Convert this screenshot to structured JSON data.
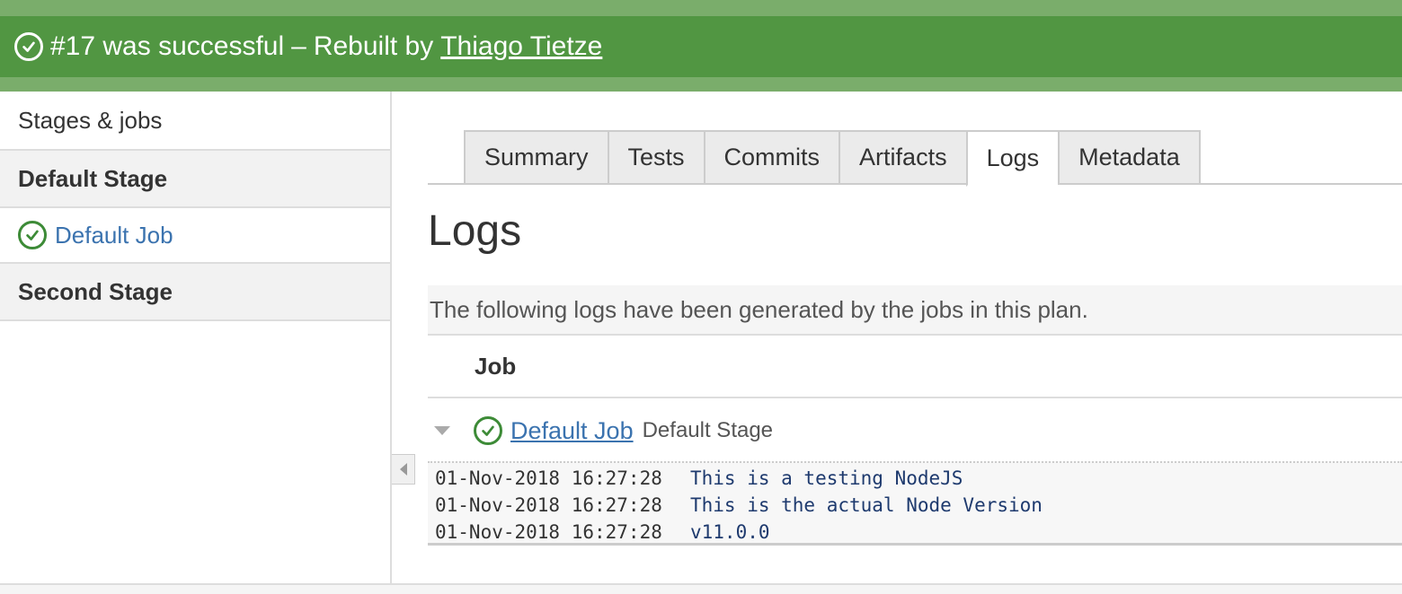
{
  "banner": {
    "status_text": "#17 was successful",
    "separator": "–",
    "rebuilt_text": "Rebuilt by",
    "user_link": "Thiago Tietze",
    "color": "#519642"
  },
  "sidebar": {
    "header": "Stages & jobs",
    "stages": [
      {
        "name": "Default Stage",
        "jobs": [
          "Default Job"
        ]
      },
      {
        "name": "Second Stage",
        "jobs": []
      }
    ]
  },
  "tabs": [
    "Summary",
    "Tests",
    "Commits",
    "Artifacts",
    "Logs",
    "Metadata"
  ],
  "active_tab": "Logs",
  "page": {
    "title": "Logs",
    "description": "The following logs have been generated by the jobs in this plan."
  },
  "table": {
    "column_header": "Job",
    "job": {
      "name": "Default Job",
      "stage": "Default Stage"
    },
    "logs": [
      {
        "time": "01-Nov-2018 16:27:28",
        "message": "This is a testing NodeJS"
      },
      {
        "time": "01-Nov-2018 16:27:28",
        "message": "This is the actual Node Version"
      },
      {
        "time": "01-Nov-2018 16:27:28",
        "message": "v11.0.0"
      }
    ]
  },
  "icons": {
    "success": "check-circle-icon",
    "collapse": "chevron-left-icon",
    "expand": "caret-down-icon"
  }
}
